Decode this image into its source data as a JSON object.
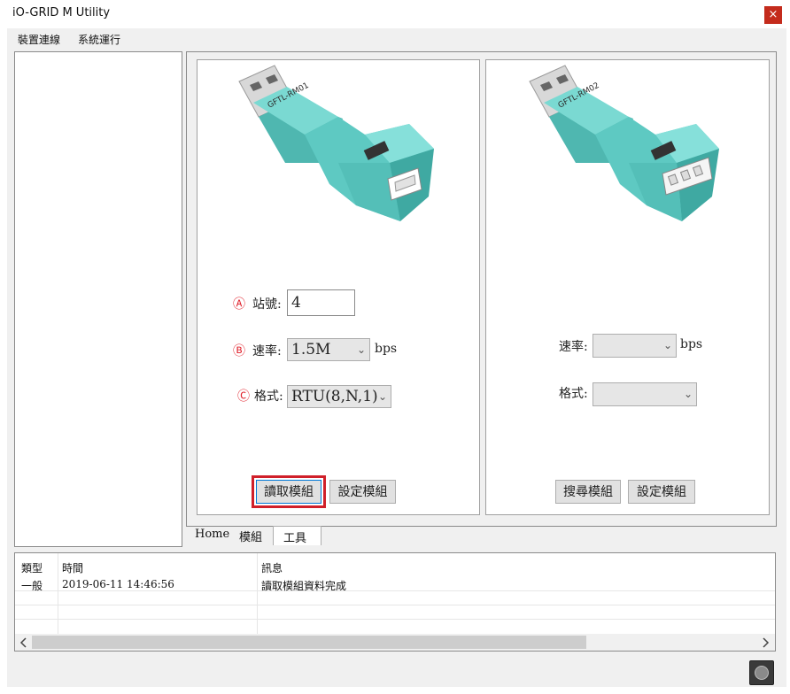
{
  "window": {
    "title": "iO-GRID M Utility",
    "close_glyph": "×"
  },
  "menu": {
    "items": [
      "裝置連線",
      "系統運行"
    ]
  },
  "card1": {
    "device_label": "GFTL-RM01",
    "station": {
      "marker": "Ⓐ",
      "label": "站號:",
      "value": "4"
    },
    "baud": {
      "marker": "Ⓑ",
      "label": "速率:",
      "value": "1.5M",
      "unit": "bps"
    },
    "format": {
      "marker": "Ⓒ",
      "label": "格式:",
      "value": "RTU(8,N,1)"
    },
    "buttons": {
      "read": "讀取模組",
      "set": "設定模組"
    }
  },
  "card2": {
    "device_label": "GFTL-RM02",
    "baud": {
      "label": "速率:",
      "value": "",
      "unit": "bps"
    },
    "format": {
      "label": "格式:",
      "value": ""
    },
    "buttons": {
      "search": "搜尋模組",
      "set": "設定模組"
    }
  },
  "tabs": [
    "Home",
    "模組",
    "工具"
  ],
  "log": {
    "columns": [
      "類型",
      "時間",
      "訊息"
    ],
    "rows": [
      {
        "type": "一般",
        "time": "2019-06-11 14:46:56",
        "message": "讀取模組資料完成"
      }
    ]
  },
  "icons": {
    "dropdown": "chevron-down-icon",
    "scroll_left": "chevron-left-icon",
    "scroll_right": "chevron-right-icon",
    "status": "status-light-icon"
  },
  "colors": {
    "device_body": "#5ec9c2",
    "highlight": "#d0202a",
    "close": "#c42b1c"
  }
}
